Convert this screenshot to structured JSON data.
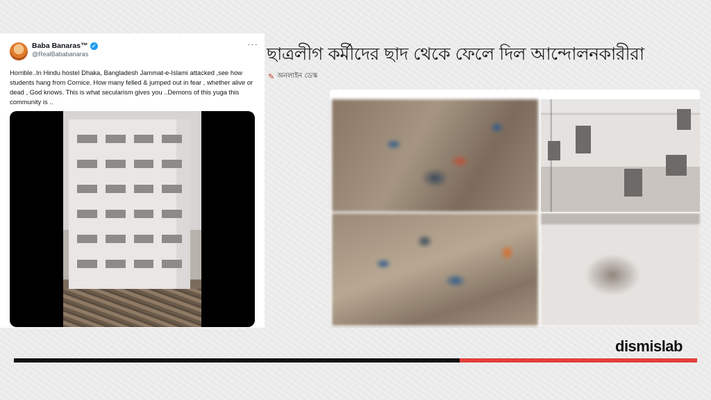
{
  "tweet": {
    "name": "Baba Banaras™",
    "handle": "@RealBababanaras",
    "more": "···",
    "text": "Horrible..In Hindu hostel Dhaka,  Bangladesh Jammat-e-Islami attacked ,see how students hang from Cornice. How many felled & jumped out in fear , whether alive or dead , God knows. This is what secularism gives you ..Demons of this yuga this community is .."
  },
  "article": {
    "headline": "ছাত্রলীগ কর্মীদের ছাদ থেকে ফেলে দিল আন্দোলনকারীরা",
    "byline": "অনলাইন ডেস্ক"
  },
  "brand": {
    "logo": "dismislab",
    "accent": "#e2403c"
  }
}
